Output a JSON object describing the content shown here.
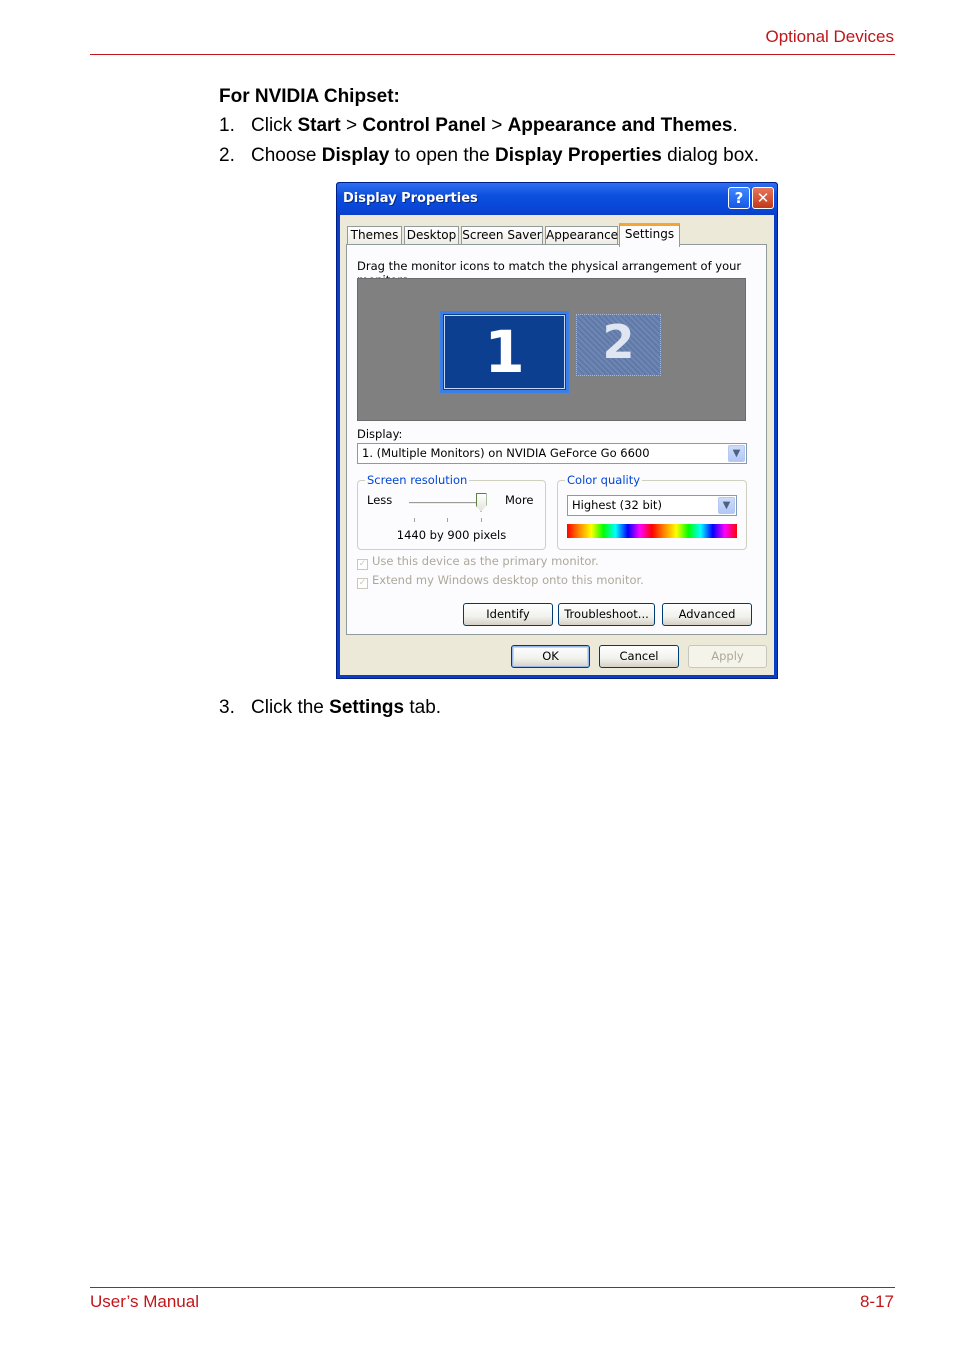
{
  "header": {
    "section": "Optional Devices"
  },
  "footer": {
    "left": "User’s Manual",
    "right": "8-17"
  },
  "content": {
    "heading": "For NVIDIA Chipset:",
    "step1": {
      "num": "1.",
      "p1": "Click ",
      "b1": "Start",
      "p2": " > ",
      "b2": "Control Panel",
      "p3": " > ",
      "b3": "Appearance and Themes",
      "p4": "."
    },
    "step2": {
      "num": "2.",
      "p1": "Choose ",
      "b1": "Display",
      "p2": " to open the ",
      "b2": "Display Properties",
      "p3": " dialog box."
    },
    "step3": {
      "num": "3.",
      "p1": "Click the ",
      "b1": "Settings",
      "p2": " tab."
    }
  },
  "dialog": {
    "title": "Display Properties",
    "help_glyph": "?",
    "close_glyph": "✕",
    "tabs": [
      "Themes",
      "Desktop",
      "Screen Saver",
      "Appearance",
      "Settings"
    ],
    "instruction": "Drag the monitor icons to match the physical arrangement of your monitors.",
    "monitor1": "1",
    "monitor2": "2",
    "display_label": "Display:",
    "display_value": "1. (Multiple Monitors) on NVIDIA GeForce Go 6600",
    "screen_resolution_label": "Screen resolution",
    "less": "Less",
    "more": "More",
    "resolution": "1440 by 900 pixels",
    "resolution_slider_level": 1.0,
    "color_quality_label": "Color quality",
    "color_quality_value": "Highest (32 bit)",
    "primary_checkbox": "Use this device as the primary monitor.",
    "extend_checkbox": "Extend my Windows desktop onto this monitor.",
    "buttons": {
      "identify": "Identify",
      "troubleshoot": "Troubleshoot...",
      "advanced": "Advanced",
      "ok": "OK",
      "cancel": "Cancel",
      "apply": "Apply"
    },
    "colors": {
      "title_bar": "#0a3fc5",
      "active_tab_accent": "#f6a532",
      "legend_text": "#0046d5"
    }
  }
}
